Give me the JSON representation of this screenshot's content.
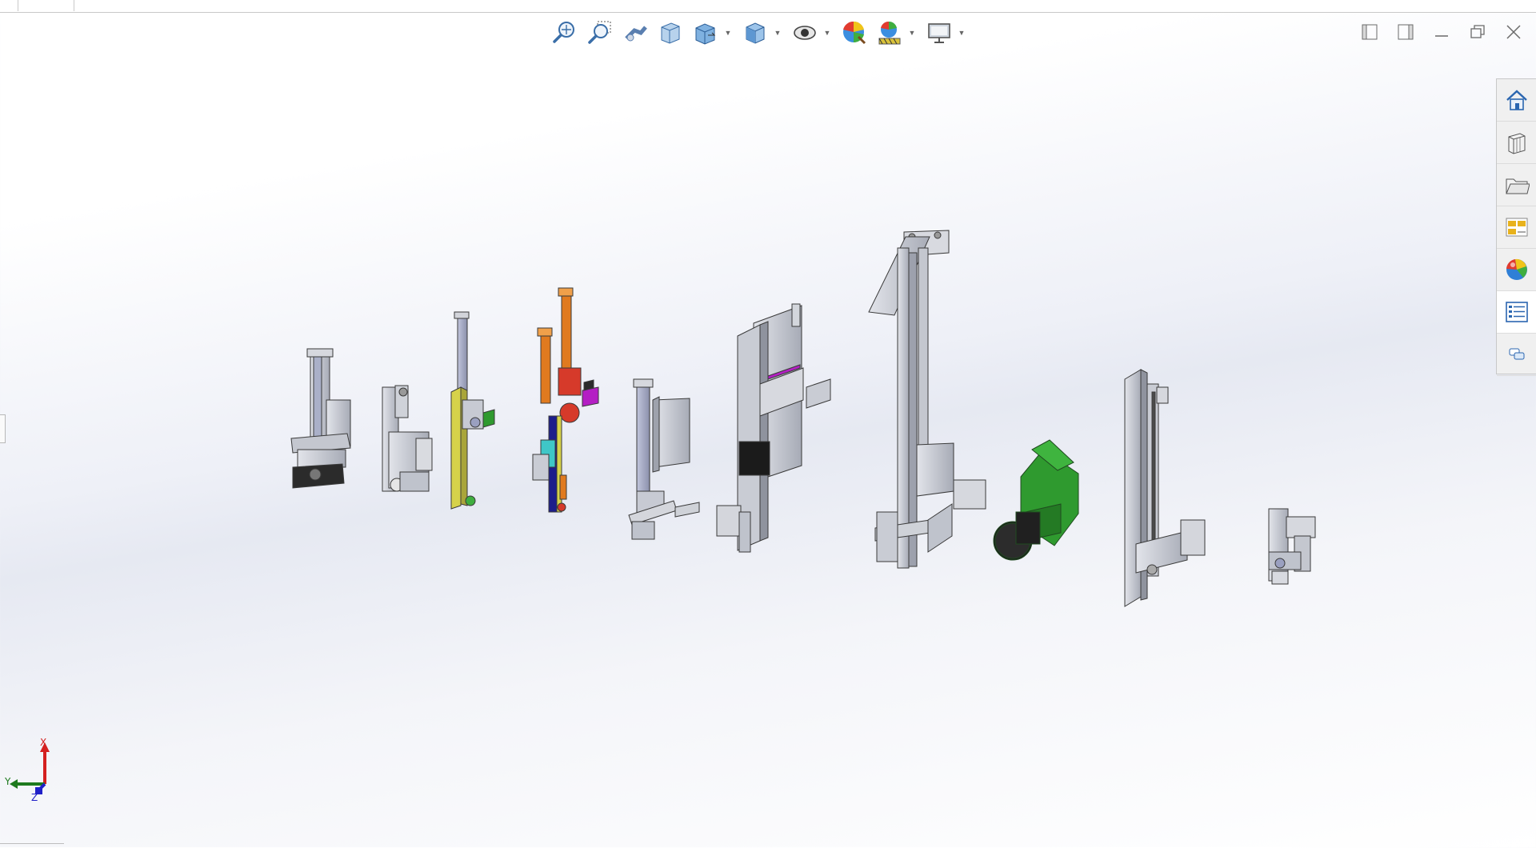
{
  "window": {
    "title": "",
    "controls": [
      "window-left-icon",
      "window-right-icon",
      "minimize-icon",
      "restore-icon",
      "close-icon"
    ]
  },
  "heads_up_toolbar": {
    "tools": [
      {
        "name": "zoom-to-fit-icon"
      },
      {
        "name": "zoom-to-area-icon"
      },
      {
        "name": "previous-view-icon"
      },
      {
        "name": "section-view-icon"
      },
      {
        "name": "view-orientation-icon",
        "has_dropdown": true
      },
      {
        "name": "display-style-icon",
        "has_dropdown": true
      },
      {
        "name": "hide-show-items-icon",
        "has_dropdown": true
      },
      {
        "name": "edit-appearance-icon"
      },
      {
        "name": "apply-scene-icon",
        "has_dropdown": true
      },
      {
        "name": "view-settings-icon",
        "has_dropdown": true
      }
    ]
  },
  "task_pane": {
    "tabs": [
      {
        "name": "resources-home-icon"
      },
      {
        "name": "design-library-icon"
      },
      {
        "name": "file-explorer-icon"
      },
      {
        "name": "view-palette-icon"
      },
      {
        "name": "appearances-scenes-icon"
      },
      {
        "name": "custom-properties-icon",
        "active": true
      },
      {
        "name": "forum-icon"
      }
    ]
  },
  "triad": {
    "x_label": "X",
    "y_label": "Y",
    "z_label": "Z"
  },
  "colors": {
    "part_grey": "#c9ccd4",
    "part_blue_grey": "#a9adc8",
    "part_orange": "#e07a1f",
    "part_red": "#d63a2a",
    "part_magenta": "#b41fc4",
    "part_yellow": "#d6d24a",
    "part_green": "#2f9a2f",
    "part_cyan": "#3fc7c7",
    "part_black": "#1b1b1b",
    "axis_x": "#d42020",
    "axis_y": "#1e7a1e",
    "axis_z": "#2020c8"
  }
}
